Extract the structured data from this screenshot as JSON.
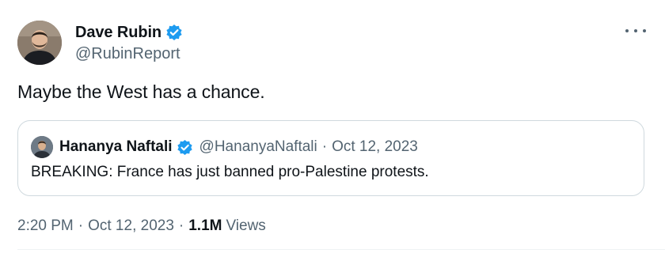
{
  "tweet": {
    "author": {
      "display_name": "Dave Rubin",
      "handle": "@RubinReport",
      "verified": true,
      "avatar_icon": "person-avatar"
    },
    "text": "Maybe the West has a chance.",
    "more_icon": "ellipsis-icon",
    "quoted_tweet": {
      "author": {
        "display_name": "Hananya Naftali",
        "handle": "@HananyaNaftali",
        "verified": true,
        "avatar_icon": "person-avatar"
      },
      "separator": "·",
      "date": "Oct 12, 2023",
      "text": "BREAKING: France has just banned pro-Palestine protests."
    },
    "meta": {
      "time": "2:20 PM",
      "separator": "·",
      "date": "Oct 12, 2023",
      "views_count": "1.1M",
      "views_label": "Views"
    }
  },
  "colors": {
    "text_primary": "#0f1419",
    "text_secondary": "#536471",
    "verified_blue": "#1d9bf0",
    "border": "#cfd9de"
  }
}
